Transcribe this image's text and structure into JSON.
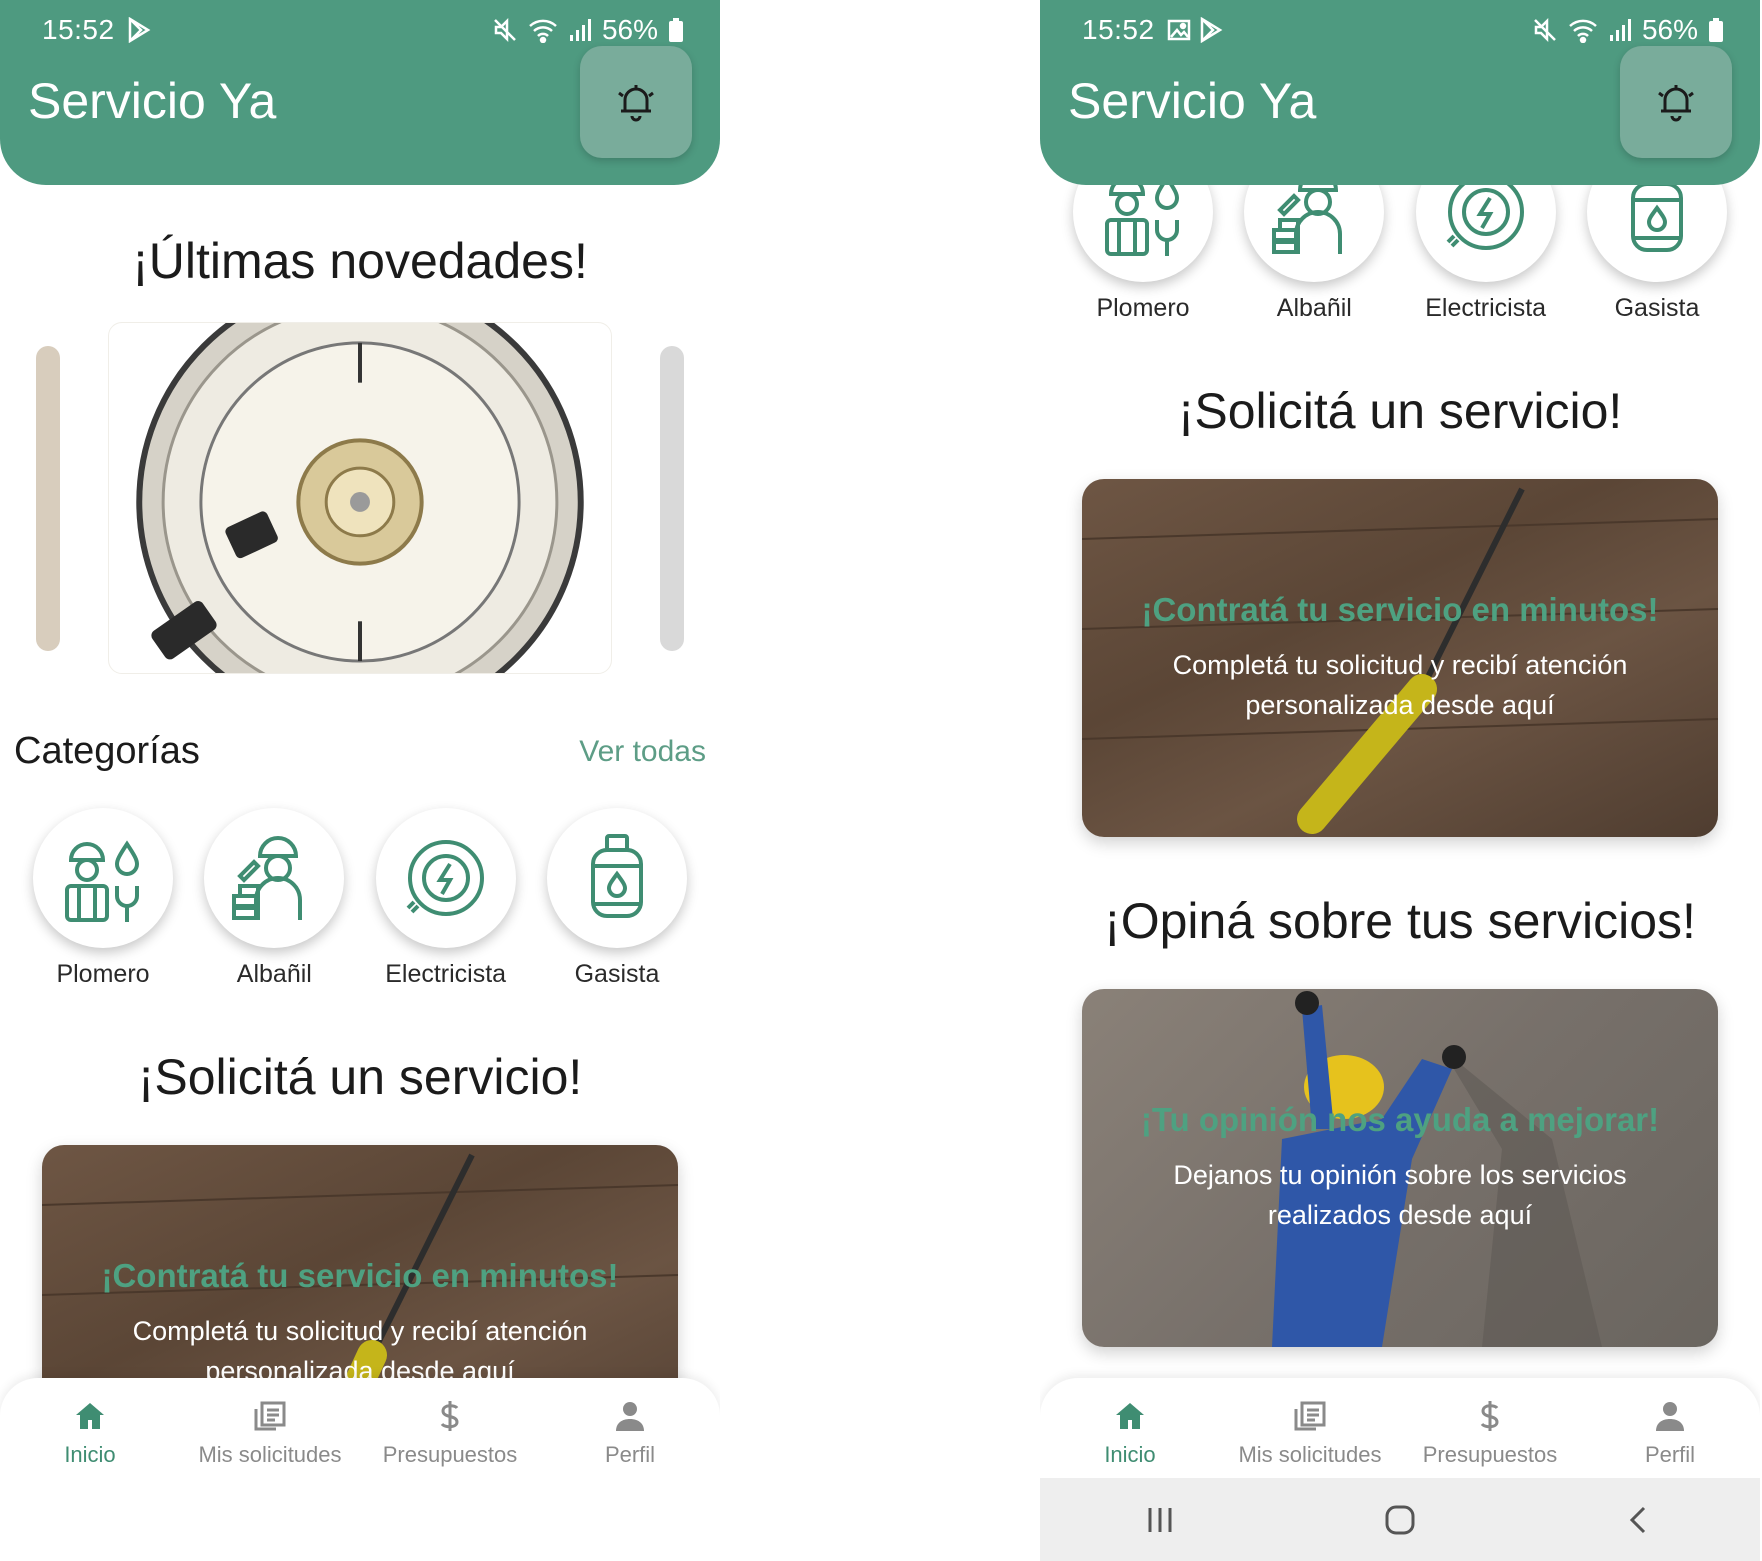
{
  "colors": {
    "brand_green": "#4e9a80",
    "bell_button": "#79ac9b",
    "accent_text": "#4ea181",
    "active_nav": "#3f8d72",
    "inactive_nav": "#8a8a8a"
  },
  "screens": [
    {
      "status": {
        "time": "15:52",
        "battery": "56%",
        "left_icons": [
          "play-store-icon"
        ],
        "right_icons": [
          "mute-icon",
          "wifi-icon",
          "signal-icon",
          "battery-icon"
        ]
      },
      "header": {
        "title": "Servicio Ya",
        "bell_icon": "bell-icon"
      },
      "news": {
        "heading": "¡Últimas novedades!"
      },
      "categories": {
        "title": "Categorías",
        "see_all": "Ver todas",
        "items": [
          {
            "label": "Plomero",
            "icon": "plumber-icon"
          },
          {
            "label": "Albañil",
            "icon": "mason-icon"
          },
          {
            "label": "Electricista",
            "icon": "electrician-icon"
          },
          {
            "label": "Gasista",
            "icon": "gas-fitter-icon"
          }
        ]
      },
      "request": {
        "heading": "¡Solicitá un servicio!",
        "card_title": "¡Contratá tu servicio en minutos!",
        "card_body": "Completá tu solicitud y recibí atención personalizada desde aquí"
      },
      "nav": [
        {
          "label": "Inicio",
          "icon": "home-icon",
          "active": true
        },
        {
          "label": "Mis solicitudes",
          "icon": "requests-icon",
          "active": false
        },
        {
          "label": "Presupuestos",
          "icon": "dollar-icon",
          "active": false
        },
        {
          "label": "Perfil",
          "icon": "person-icon",
          "active": false
        }
      ]
    },
    {
      "status": {
        "time": "15:52",
        "battery": "56%",
        "left_icons": [
          "gallery-icon",
          "play-store-icon"
        ],
        "right_icons": [
          "mute-icon",
          "wifi-icon",
          "signal-icon",
          "battery-icon"
        ]
      },
      "header": {
        "title": "Servicio Ya",
        "bell_icon": "bell-icon"
      },
      "categories": {
        "items": [
          {
            "label": "Plomero",
            "icon": "plumber-icon"
          },
          {
            "label": "Albañil",
            "icon": "mason-icon"
          },
          {
            "label": "Electricista",
            "icon": "electrician-icon"
          },
          {
            "label": "Gasista",
            "icon": "gas-fitter-icon"
          }
        ]
      },
      "request": {
        "heading": "¡Solicitá un servicio!",
        "card_title": "¡Contratá tu servicio en minutos!",
        "card_body": "Completá tu solicitud y recibí atención personalizada desde aquí"
      },
      "review": {
        "heading": "¡Opiná sobre tus servicios!",
        "card_title": "¡Tu opinión nos ayuda a mejorar!",
        "card_body": "Dejanos tu opinión sobre los servicios realizados desde aquí"
      },
      "nav": [
        {
          "label": "Inicio",
          "icon": "home-icon",
          "active": true
        },
        {
          "label": "Mis solicitudes",
          "icon": "requests-icon",
          "active": false
        },
        {
          "label": "Presupuestos",
          "icon": "dollar-icon",
          "active": false
        },
        {
          "label": "Perfil",
          "icon": "person-icon",
          "active": false
        }
      ],
      "system_nav": [
        "recents-icon",
        "home-circle-icon",
        "back-icon"
      ]
    }
  ]
}
